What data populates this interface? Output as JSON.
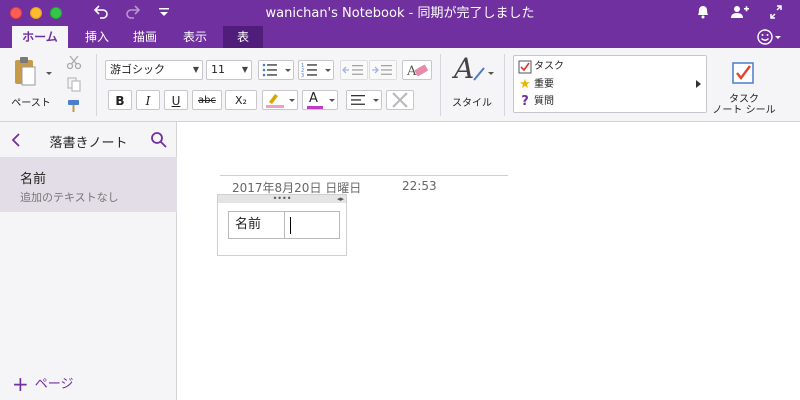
{
  "window": {
    "title": "wanichan's Notebook - 同期が完了しました"
  },
  "toolbar_icons": {
    "undo": "undo-icon",
    "redo": "redo-icon",
    "customize": "customize-icon",
    "bell": "bell-icon",
    "add_user": "add-user-icon",
    "expand": "expand-icon",
    "smiley": "smiley-icon"
  },
  "tabs": [
    {
      "label": "ホーム",
      "active": true
    },
    {
      "label": "挿入",
      "active": false
    },
    {
      "label": "描画",
      "active": false
    },
    {
      "label": "表示",
      "active": false
    },
    {
      "label": "表",
      "active": false
    }
  ],
  "ribbon": {
    "paste_label": "ペースト",
    "font_name": "游ゴシック",
    "font_size": "11",
    "bold": "B",
    "italic": "I",
    "underline": "U",
    "strike": "abc",
    "subscript": "X₂",
    "font_color_letter": "A",
    "styles_letter": "A",
    "styles_label": "スタイル",
    "tags": [
      {
        "label": "タスク",
        "icon": "checkbox-icon"
      },
      {
        "label": "重要",
        "icon": "star-icon"
      },
      {
        "label": "質問",
        "icon": "question-icon"
      }
    ],
    "task_tag_label_line1": "タスク",
    "task_tag_label_line2": "ノート シール"
  },
  "colors": {
    "accent": "#7030a0",
    "highlight": "#f0a0c8",
    "font_color": "#c03bc6",
    "star": "#f0b400"
  },
  "sidebar": {
    "title": "落書きノート",
    "pages": [
      {
        "title": "名前",
        "subtitle": "追加のテキストなし"
      }
    ],
    "add_page": "ページ"
  },
  "page": {
    "date": "2017年8月20日 日曜日",
    "time": "22:53",
    "table_cell": "名前"
  }
}
